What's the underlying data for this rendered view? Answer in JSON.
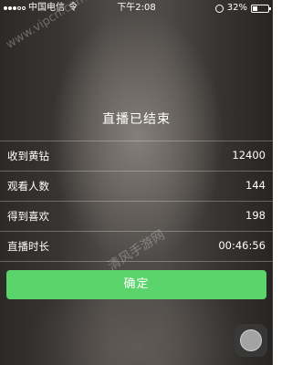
{
  "status_bar": {
    "carrier": "中国电信",
    "network": "令",
    "time": "下午2:08",
    "battery": "32%",
    "battery_level": 0.32
  },
  "watermarks": {
    "top_left": "www.vipcn.com",
    "center": "清风手游网"
  },
  "title": "直播已结束",
  "stats": [
    {
      "label": "收到黄钻",
      "value": "12400"
    },
    {
      "label": "观看人数",
      "value": "144"
    },
    {
      "label": "得到喜欢",
      "value": "198"
    },
    {
      "label": "直播时长",
      "value": "00:46:56"
    }
  ],
  "confirm_label": "确定",
  "colors": {
    "confirm_button": "#5bd46c"
  }
}
